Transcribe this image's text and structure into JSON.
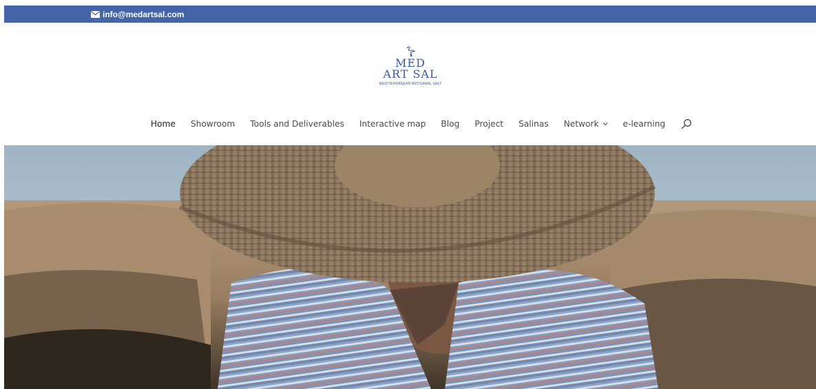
{
  "topbar": {
    "email": "info@medartsal.com",
    "email_icon": "envelope-icon",
    "color": "#4466a8"
  },
  "logo": {
    "line1": "MED",
    "line2": "ART SAL",
    "tagline": "MEDITERRANEAN ARTISANAL SALT",
    "icon": "flamingo-icon",
    "color": "#3a5aa0"
  },
  "nav": {
    "items": [
      {
        "label": "Home"
      },
      {
        "label": "Showroom"
      },
      {
        "label": "Tools and Deliverables"
      },
      {
        "label": "Interactive map"
      },
      {
        "label": "Blog"
      },
      {
        "label": "Project"
      },
      {
        "label": "Salinas"
      },
      {
        "label": "Network"
      },
      {
        "label": "e-learning"
      }
    ],
    "search_icon": "search-icon"
  },
  "hero": {
    "image": "salt worker with straw hat"
  }
}
